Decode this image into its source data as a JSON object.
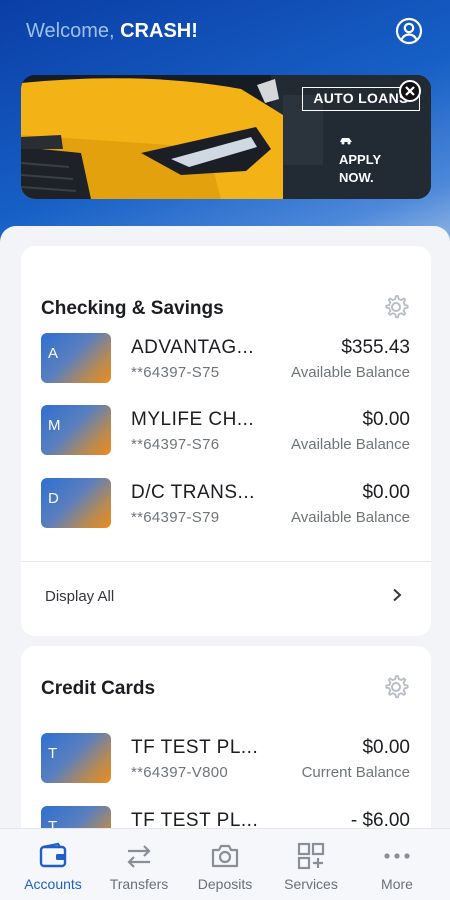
{
  "header": {
    "welcome_prefix": "Welcome,",
    "user_name": "CRASH!"
  },
  "banner": {
    "tag": "AUTO LOANS",
    "cta_line1": "APPLY",
    "cta_line2": "NOW."
  },
  "checking": {
    "title": "Checking & Savings",
    "accounts": [
      {
        "initial": "A",
        "name": "ADVANTAG...",
        "number": "**64397-S75",
        "amount": "$355.43",
        "label": "Available Balance"
      },
      {
        "initial": "M",
        "name": "MYLIFE CH...",
        "number": "**64397-S76",
        "amount": "$0.00",
        "label": "Available Balance"
      },
      {
        "initial": "D",
        "name": "D/C TRANS...",
        "number": "**64397-S79",
        "amount": "$0.00",
        "label": "Available Balance"
      }
    ],
    "display_all": "Display All"
  },
  "credit": {
    "title": "Credit Cards",
    "accounts": [
      {
        "initial": "T",
        "name": "TF TEST PL...",
        "number": "**64397-V800",
        "amount": "$0.00",
        "label": "Current Balance"
      },
      {
        "initial": "T",
        "name": "TF TEST PL...",
        "amount": "- $6.00"
      }
    ]
  },
  "nav": {
    "items": [
      {
        "label": "Accounts",
        "icon": "wallet-icon",
        "active": true
      },
      {
        "label": "Transfers",
        "icon": "transfer-arrows-icon"
      },
      {
        "label": "Deposits",
        "icon": "camera-icon"
      },
      {
        "label": "Services",
        "icon": "grid-plus-icon"
      },
      {
        "label": "More",
        "icon": "more-dots-icon"
      }
    ]
  },
  "colors": {
    "brand_blue": "#1760c6",
    "accent_orange": "#f08a1c",
    "active_nav": "#1e5fc9",
    "banner_car": "#f3b316"
  }
}
